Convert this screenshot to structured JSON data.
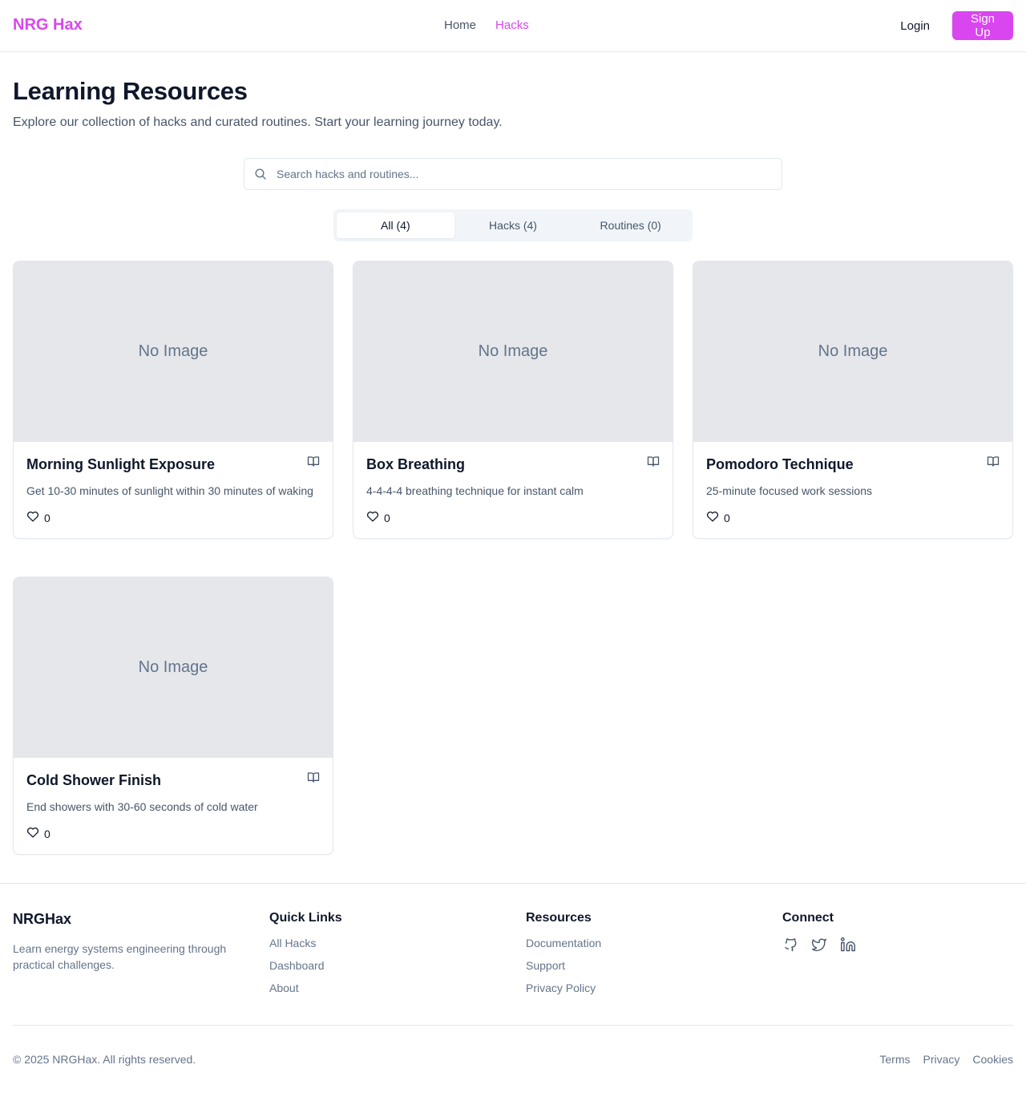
{
  "header": {
    "logo": "NRG Hax",
    "nav": [
      {
        "label": "Home",
        "active": false
      },
      {
        "label": "Hacks",
        "active": true
      }
    ],
    "login_label": "Login",
    "signup_label": "Sign Up"
  },
  "intro": {
    "title": "Learning Resources",
    "subtitle": "Explore our collection of hacks and curated routines. Start your learning journey today."
  },
  "search": {
    "placeholder": "Search hacks and routines..."
  },
  "tabs": [
    {
      "label": "All (4)",
      "active": true
    },
    {
      "label": "Hacks (4)",
      "active": false
    },
    {
      "label": "Routines (0)",
      "active": false
    }
  ],
  "cards": [
    {
      "image_label": "No Image",
      "title": "Morning Sunlight Exposure",
      "description": "Get 10-30 minutes of sunlight within 30 minutes of waking",
      "likes": "0"
    },
    {
      "image_label": "No Image",
      "title": "Box Breathing",
      "description": "4-4-4-4 breathing technique for instant calm",
      "likes": "0"
    },
    {
      "image_label": "No Image",
      "title": "Pomodoro Technique",
      "description": "25-minute focused work sessions",
      "likes": "0"
    },
    {
      "image_label": "No Image",
      "title": "Cold Shower Finish",
      "description": "End showers with 30-60 seconds of cold water",
      "likes": "0"
    }
  ],
  "footer": {
    "brand": "NRGHax",
    "tagline": "Learn energy systems engineering through practical challenges.",
    "quick_links": {
      "heading": "Quick Links",
      "items": [
        "All Hacks",
        "Dashboard",
        "About"
      ]
    },
    "resources": {
      "heading": "Resources",
      "items": [
        "Documentation",
        "Support",
        "Privacy Policy"
      ]
    },
    "connect": {
      "heading": "Connect",
      "icons": [
        "github-icon",
        "twitter-icon",
        "linkedin-icon"
      ]
    },
    "copyright": "© 2025 NRGHax. All rights reserved.",
    "legal": [
      "Terms",
      "Privacy",
      "Cookies"
    ]
  },
  "colors": {
    "accent": "#d946ef",
    "muted_text": "#64748b",
    "placeholder_bg": "#e5e7eb"
  }
}
